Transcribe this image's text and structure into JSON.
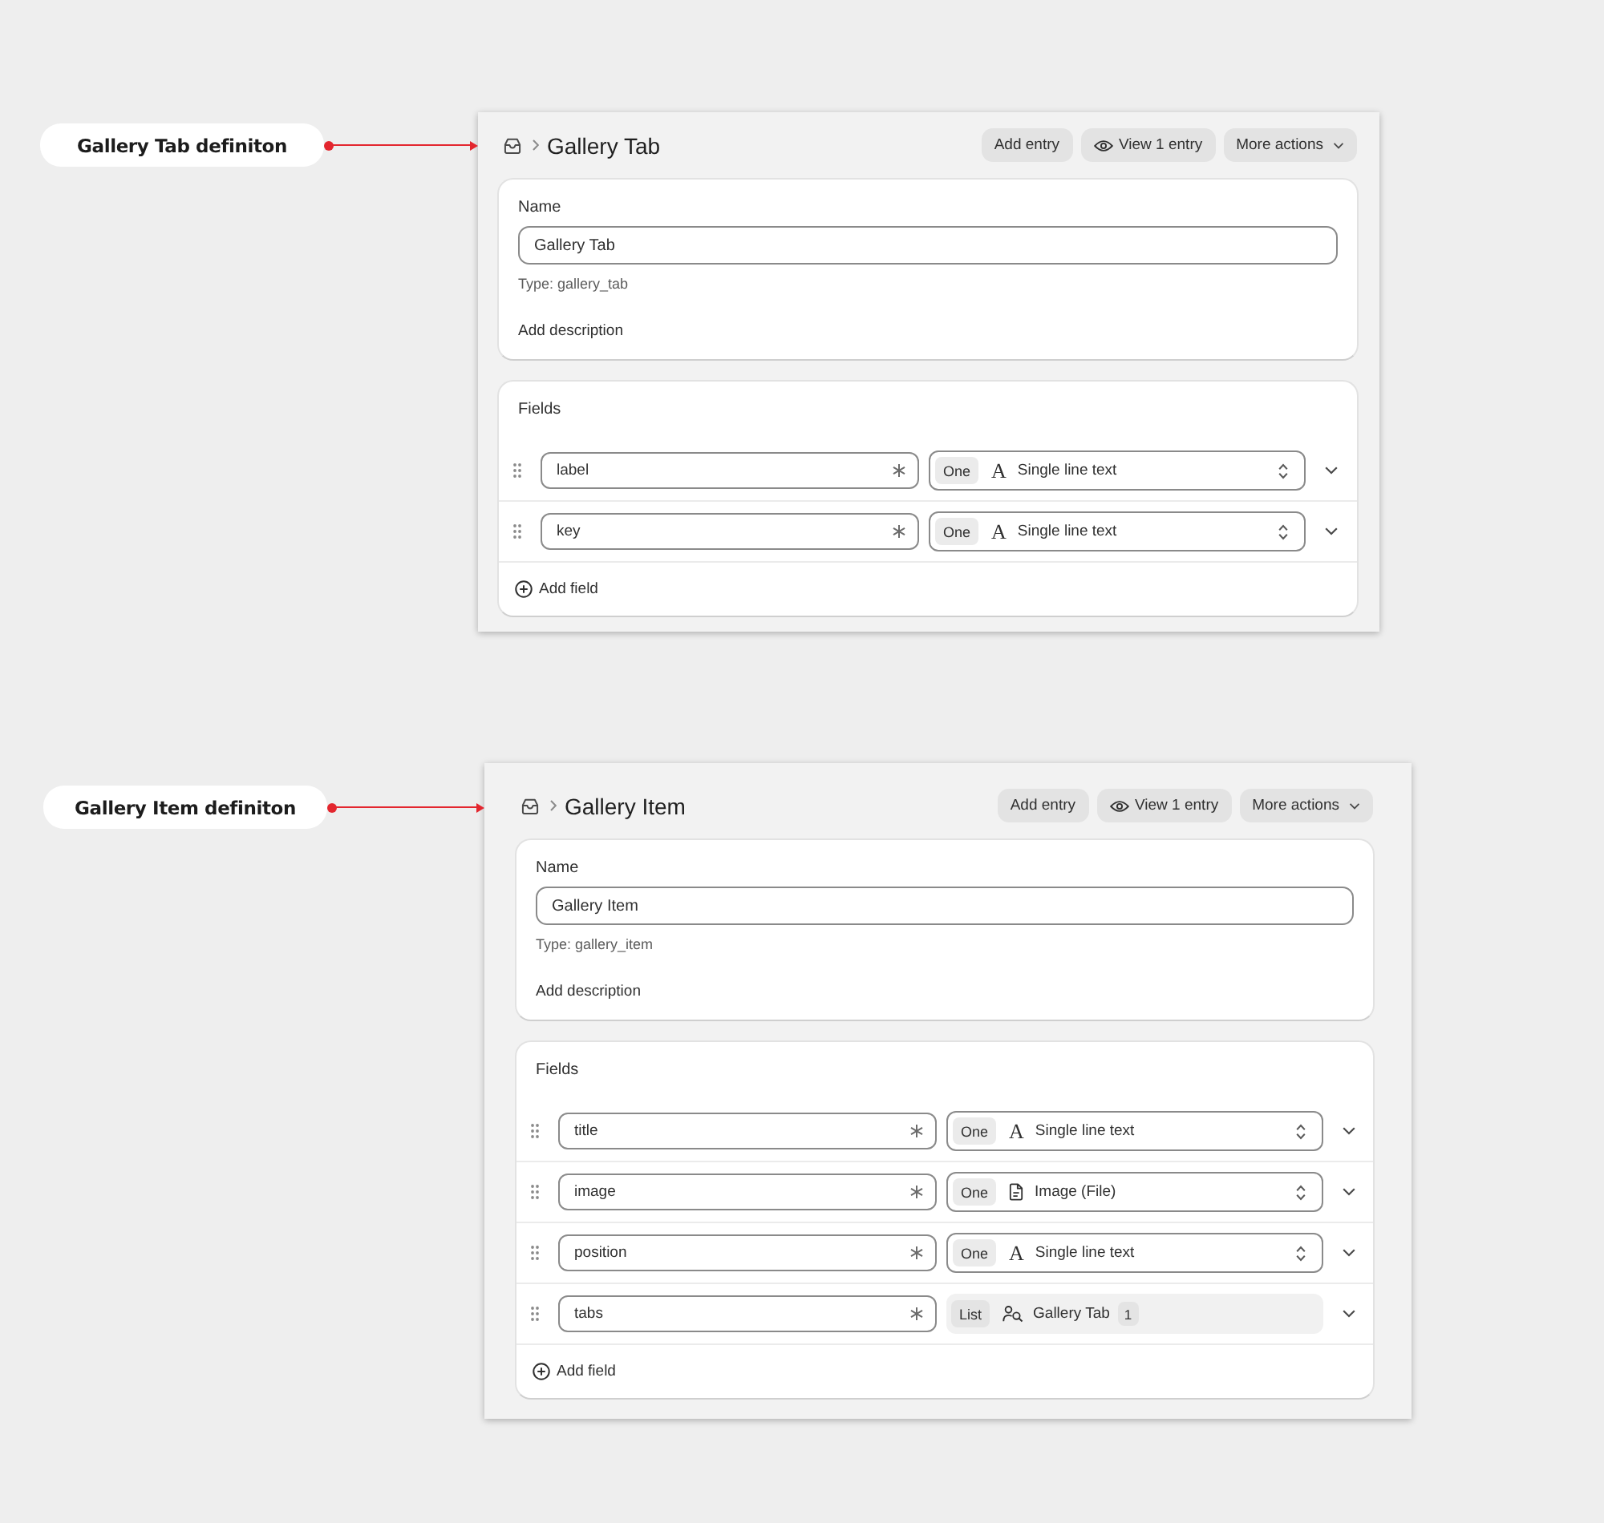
{
  "definitions": [
    {
      "callout": "Gallery Tab definiton",
      "title": "Gallery Tab",
      "actions": [
        {
          "label": "Add entry",
          "kind": "plain"
        },
        {
          "label": "View 1 entry",
          "kind": "view"
        },
        {
          "label": "More actions",
          "kind": "menu"
        }
      ],
      "name_card": {
        "label": "Name",
        "value": "Gallery Tab",
        "type_note": "Type: gallery_tab",
        "add_description": "Add description"
      },
      "fields_card": {
        "heading": "Fields",
        "fields": [
          {
            "name": "label",
            "kind": "text",
            "cardinality": "One",
            "glyph": "A",
            "type": "Single line text"
          },
          {
            "name": "key",
            "kind": "text",
            "cardinality": "One",
            "glyph": "A",
            "type": "Single line text"
          }
        ],
        "add_field": "Add field"
      }
    },
    {
      "callout": "Gallery Item definiton",
      "title": "Gallery Item",
      "actions": [
        {
          "label": "Add entry",
          "kind": "plain"
        },
        {
          "label": "View 1 entry",
          "kind": "view"
        },
        {
          "label": "More actions",
          "kind": "menu"
        }
      ],
      "name_card": {
        "label": "Name",
        "value": "Gallery Item",
        "type_note": "Type: gallery_item",
        "add_description": "Add description"
      },
      "fields_card": {
        "heading": "Fields",
        "fields": [
          {
            "name": "title",
            "kind": "text",
            "cardinality": "One",
            "glyph": "A",
            "type": "Single line text"
          },
          {
            "name": "image",
            "kind": "file",
            "cardinality": "One",
            "type": "Image (File)"
          },
          {
            "name": "position",
            "kind": "text",
            "cardinality": "One",
            "glyph": "A",
            "type": "Single line text"
          },
          {
            "name": "tabs",
            "kind": "reference",
            "cardinality": "List",
            "type": "Gallery Tab",
            "count": "1"
          }
        ],
        "add_field": "Add field"
      }
    }
  ]
}
